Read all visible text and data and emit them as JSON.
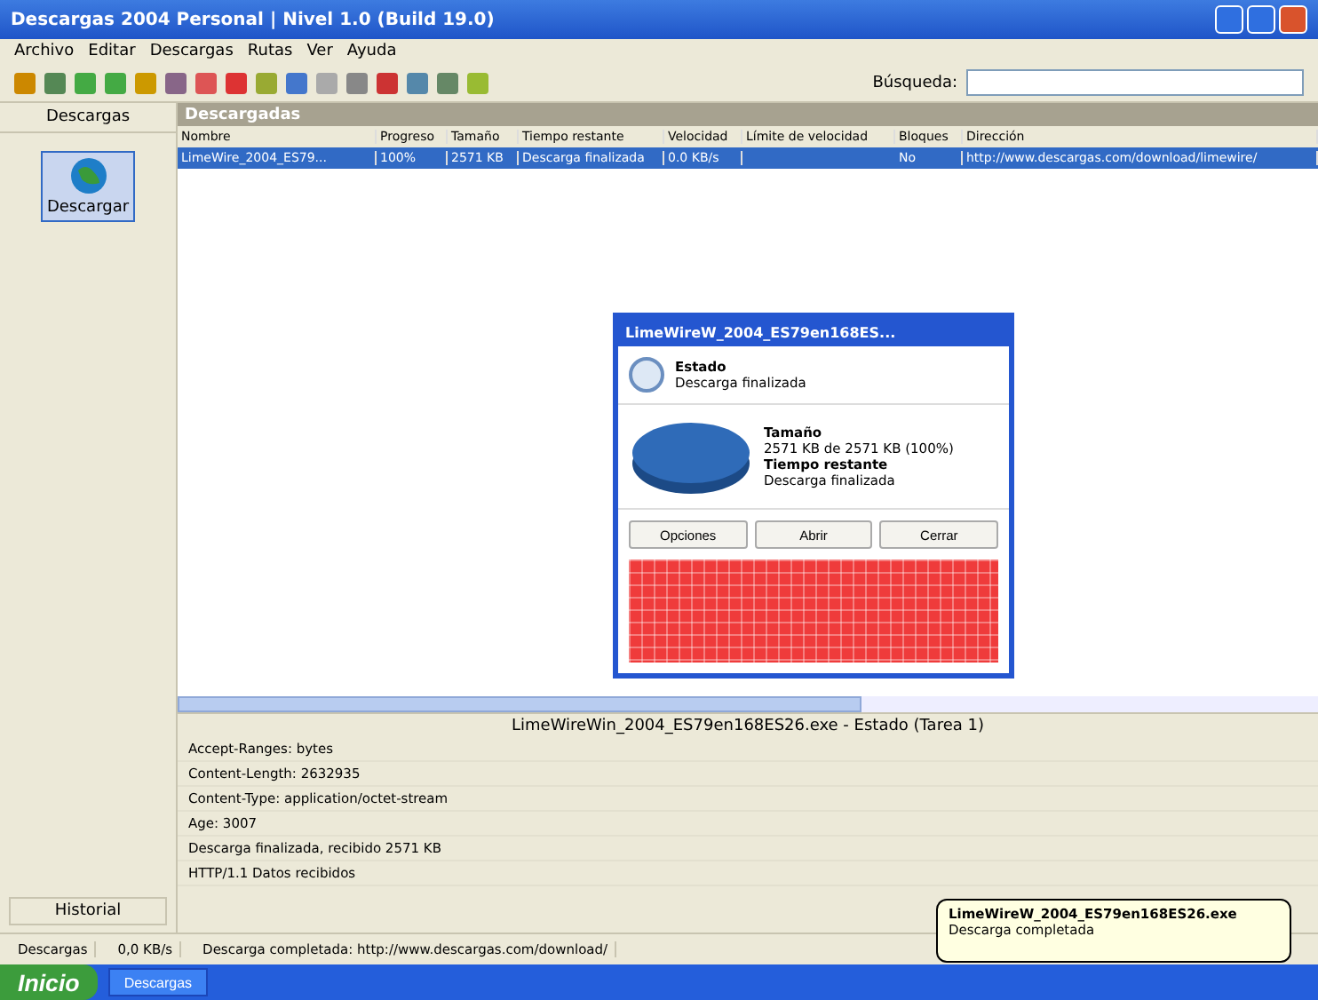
{
  "window": {
    "title": "Descargas 2004 Personal | Nivel 1.0 (Build 19.0)"
  },
  "menu": [
    "Archivo",
    "Editar",
    "Descargas",
    "Rutas",
    "Ver",
    "Ayuda"
  ],
  "search": {
    "label": "Búsqueda:"
  },
  "sidebar": {
    "header": "Descargas",
    "items": [
      {
        "label": "Descargar",
        "selected": true
      }
    ],
    "footer": "Historial"
  },
  "folder": {
    "title": "Descargadas"
  },
  "table": {
    "columns": [
      "Nombre",
      "Progreso",
      "Tamaño",
      "Tiempo restante",
      "Velocidad",
      "Límite de velocidad",
      "Bloques",
      "Dirección"
    ],
    "rows": [
      {
        "selected": true,
        "cells": [
          "LimeWire_2004_ES79...",
          "100%",
          "2571 KB",
          "Descarga finalizada",
          "0.0 KB/s",
          "",
          "No",
          "http://www.descargas.com/download/limewire/"
        ]
      }
    ]
  },
  "log": {
    "title": "LimeWireWin_2004_ES79en168ES26.exe - Estado (Tarea 1)",
    "lines": [
      "Accept-Ranges: bytes",
      "Content-Length: 2632935",
      "Content-Type: application/octet-stream",
      "Age: 3007",
      "Descarga finalizada, recibido 2571 KB",
      "HTTP/1.1 Datos recibidos"
    ]
  },
  "status_bar": [
    "Descargas",
    "0,0 KB/s",
    "Descarga completada: http://www.descargas.com/download/"
  ],
  "dialog": {
    "title": "LimeWireW_2004_ES79en168ES...",
    "status_label": "Estado",
    "status": "Descarga finalizada",
    "size_label": "Tamaño",
    "size": "2571 KB de 2571 KB (100%)",
    "time_label": "Tiempo restante",
    "time": "Descarga finalizada",
    "buttons": [
      "Opciones",
      "Abrir",
      "Cerrar"
    ],
    "level": 1
  },
  "balloon": {
    "title": "LimeWireW_2004_ES79en168ES26.exe",
    "text": "Descarga completada"
  },
  "taskbar": {
    "start": "Inicio",
    "tasks": [
      "Descargas"
    ]
  }
}
